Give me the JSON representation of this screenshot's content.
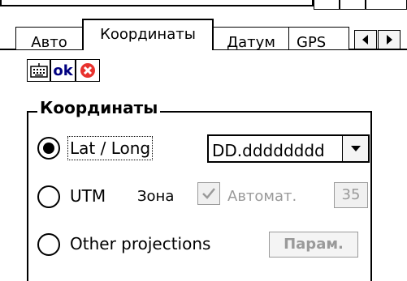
{
  "tabs": [
    {
      "label": "Авто"
    },
    {
      "label": "Координаты"
    },
    {
      "label": "Датум"
    },
    {
      "label": "GPS"
    }
  ],
  "toolbar": {
    "ok_label": "ok"
  },
  "group": {
    "title": "Координаты"
  },
  "options": {
    "latlong": {
      "label": "Lat / Long",
      "selected": true
    },
    "utm": {
      "label": "UTM",
      "selected": false
    },
    "other": {
      "label": "Other projections",
      "selected": false
    }
  },
  "format_select": {
    "value": "DD.dddddddd"
  },
  "utm_zone": {
    "label": "Зона",
    "auto_label": "Автомат.",
    "auto_checked": true,
    "zone_value": "35"
  },
  "params_button": {
    "label": "Парам."
  }
}
